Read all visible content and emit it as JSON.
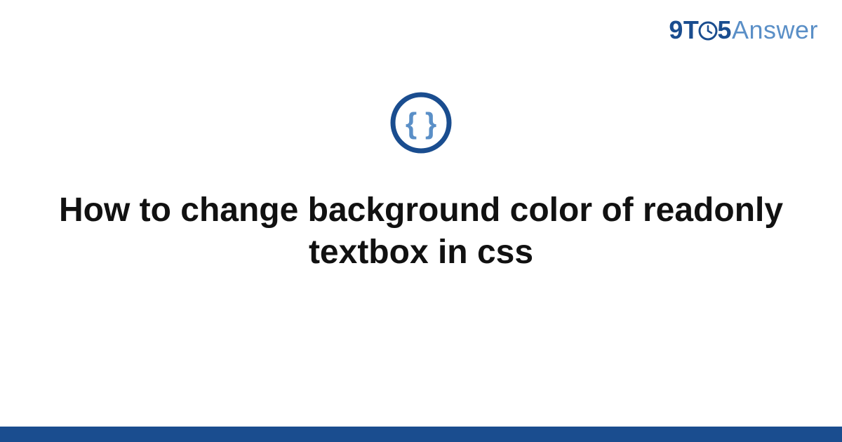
{
  "brand": {
    "part1": "9",
    "part2": "T",
    "part3": "5",
    "part4": "Answer"
  },
  "title": "How to change background color of readonly textbox in css",
  "colors": {
    "brand_dark": "#1a4d8f",
    "brand_light": "#5a8fc7",
    "icon_ring": "#1a4d8f",
    "icon_brace": "#5a8fc7"
  }
}
